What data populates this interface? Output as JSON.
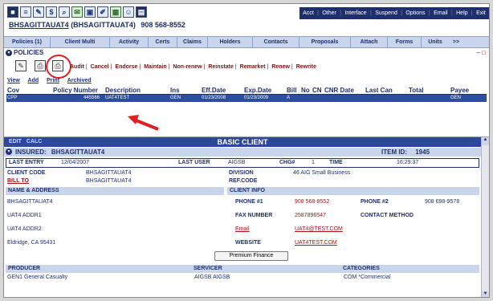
{
  "header": {
    "client_name": "BHSAGITTAUAT4",
    "client_code_paren": "(BHSAGITTAUAT4)",
    "phone": "908 568-8552",
    "toolbar_icons": [
      "save-icon",
      "list-icon",
      "edit-icon",
      "dollar-icon",
      "search-icon",
      "notes-icon",
      "picture-icon",
      "pen-icon",
      "calendar-icon",
      "users-icon",
      "clipboard-icon"
    ],
    "menu": [
      "Acct",
      "Other",
      "Interface",
      "Suspend",
      "Options",
      "Email",
      "Help",
      "Exit"
    ]
  },
  "tabs": [
    "Policies (1)",
    "Client Multi",
    "Activity",
    "Certs",
    "Claims",
    "Holders",
    "Contacts",
    "Proposals",
    "Attach",
    "Forms",
    "Units"
  ],
  "tabs_more": ">>",
  "policies": {
    "title": "POLICIES",
    "actions": [
      "Audit",
      "Cancel",
      "Endorse",
      "Maintain",
      "Non-renew",
      "Reinstate",
      "Remarket",
      "Renew",
      "Rewrite"
    ],
    "sub_actions": [
      "View",
      "Add",
      "Print",
      "Archived"
    ],
    "columns": [
      "Cov",
      "Policy Number",
      "Description",
      "Ins",
      "Eff.Date",
      "Exp.Date",
      "Bill",
      "No",
      "CN",
      "CNR Date",
      "Last Can",
      "Total",
      "Payee"
    ],
    "rows": [
      {
        "cov": "CPP",
        "policy_number": "445566",
        "description": "UAT4TEST",
        "ins": "GEN",
        "eff_date": "01/23/2008",
        "exp_date": "01/23/2009",
        "bill": "A",
        "no": "",
        "cn": "",
        "cnr_date": "",
        "last_can": "",
        "total": "",
        "payee": "GEN"
      }
    ]
  },
  "detail": {
    "edit": "EDIT",
    "calc": "CALC",
    "title": "BASIC CLIENT",
    "insured_label": "INSURED:",
    "insured_name": "BHSAGITTAUAT4",
    "item_id_label": "ITEM ID:",
    "item_id": "1945",
    "last_entry_label": "LAST ENTRY",
    "last_entry": "12/04/2007",
    "last_user_label": "LAST USER",
    "last_user": "AIGSB",
    "chg_label": "CHG#",
    "chg": "1",
    "time_label": "TIME",
    "time": "16:29:37",
    "client_code_label": "CLIENT CODE",
    "client_code": "BHSAGITTAUAT4",
    "bill_to_label": "BILL TO",
    "bill_to": "BHSAGITTAUAT4",
    "division_label": "DIVISION",
    "division": "46 AIG Small Business",
    "ref_code_label": "REF.CODE",
    "name_address_label": "NAME & ADDRESS",
    "client_info_label": "CLIENT INFO",
    "address": [
      "BHSAGITTAUAT4",
      "UAT4 ADDR1",
      "UAT4 ADDR2",
      "Eldridge, CA  95431"
    ],
    "phone1_label": "PHONE #1",
    "phone1": "908 568-8552",
    "phone2_label": "PHONE #2",
    "phone2": "908 698-9578",
    "fax_label": "FAX NUMBER",
    "fax": "2587896547",
    "contact_method_label": "CONTACT METHOD",
    "email_label": "Email",
    "email": "UAT4@TEST.COM",
    "website_label": "WEBSITE",
    "website": "UAT4TEST.COM",
    "premium_finance": "Premium Finance",
    "producer_label": "PRODUCER",
    "producer": "GEN1 General Casualty",
    "servicer_label": "SERVICER",
    "servicer": "AIGSB AIGSB",
    "categories_label": "CATEGORIES",
    "categories": "COM *Commercial"
  },
  "colors": {
    "navy": "#1f2f6e",
    "highlight": "#2d4da0",
    "annotation": "#e02020"
  }
}
